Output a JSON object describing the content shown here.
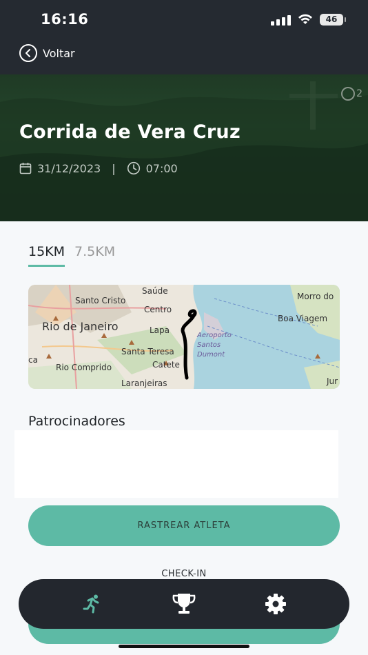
{
  "status_bar": {
    "time": "16:16",
    "battery": "46"
  },
  "header": {
    "back_label": "Voltar"
  },
  "event": {
    "title": "Corrida de Vera Cruz",
    "date": "31/12/2023",
    "separator": "|",
    "time": "07:00",
    "badge": "2"
  },
  "tabs": [
    {
      "label": "15KM",
      "active": true
    },
    {
      "label": "7.5KM",
      "active": false
    }
  ],
  "map": {
    "labels": [
      "Saúde",
      "Santo Cristo",
      "Centro",
      "Morro do",
      "Rio de Janeiro",
      "Boa Viagem",
      "Lapa",
      "Aeroporto",
      "Santos",
      "Dumont",
      "Santa Teresa",
      "Catete",
      "Rio Comprido",
      "Laranjeiras",
      "ca",
      "Jur"
    ]
  },
  "sponsors": {
    "title": "Patrocinadores"
  },
  "actions": {
    "track_label": "RASTREAR ATLETA",
    "checkin_label": "CHECK-IN"
  },
  "nav": {
    "items": [
      "running-icon",
      "trophy-icon",
      "gear-icon"
    ]
  },
  "colors": {
    "accent": "#5dbaa5",
    "dark": "#252a31",
    "navbar": "#23272e"
  }
}
